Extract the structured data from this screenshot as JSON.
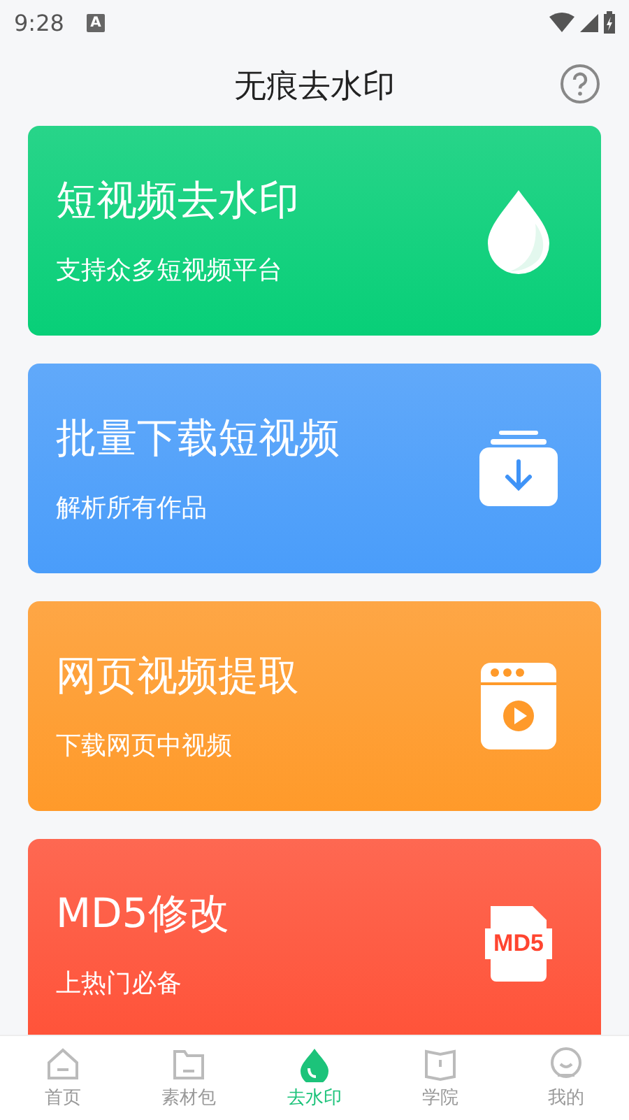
{
  "status_bar": {
    "time": "9:28",
    "notification": "A"
  },
  "header": {
    "title": "无痕去水印"
  },
  "cards": [
    {
      "kind": "drop",
      "title": "短视频去水印",
      "subtitle": "支持众多短视频平台",
      "color": "#08cf78"
    },
    {
      "kind": "download",
      "title": "批量下载短视频",
      "subtitle": "解析所有作品",
      "color": "#4a9dfa"
    },
    {
      "kind": "video",
      "title": "网页视频提取",
      "subtitle": "下载网页中视频",
      "color": "#ff9a2a"
    },
    {
      "kind": "md5",
      "title": "MD5修改",
      "subtitle": "上热门必备",
      "color": "#ff5238",
      "badge": "MD5"
    }
  ],
  "tabs": [
    {
      "kind": "home",
      "label": "首页",
      "selected": false
    },
    {
      "kind": "folder",
      "label": "素材包",
      "selected": false
    },
    {
      "kind": "drop",
      "label": "去水印",
      "selected": true
    },
    {
      "kind": "book",
      "label": "学院",
      "selected": false
    },
    {
      "kind": "face",
      "label": "我的",
      "selected": false
    }
  ]
}
